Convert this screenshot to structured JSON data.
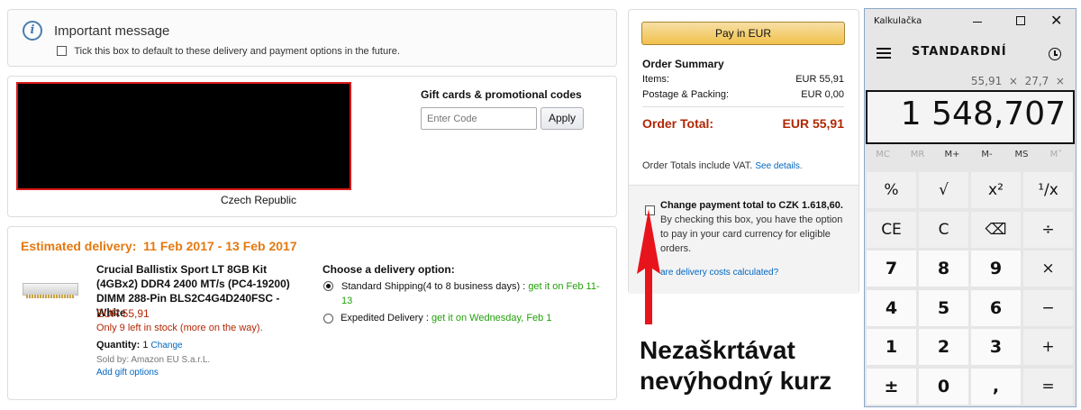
{
  "important": {
    "title": "Important message",
    "checkbox_label": "Tick this box to default to these delivery and payment options in the future."
  },
  "address": {
    "country": "Czech Republic"
  },
  "gift": {
    "title": "Gift cards & promotional codes",
    "placeholder": "Enter Code",
    "apply": "Apply"
  },
  "delivery": {
    "estimated_label": "Estimated delivery:",
    "estimated_dates": "11 Feb 2017 - 13 Feb 2017",
    "product_name": "Crucial Ballistix Sport LT 8GB Kit (4GBx2) DDR4 2400 MT/s (PC4-19200) DIMM 288-Pin BLS2C4G4D240FSC - White",
    "price": "EUR 55,91",
    "stock": "Only 9 left in stock (more on the way).",
    "quantity_label": "Quantity:",
    "quantity_value": "1",
    "change": "Change",
    "sold_by": "Sold by: Amazon EU S.a.r.L.",
    "gift_options": "Add gift options",
    "choose_label": "Choose a delivery option:",
    "option1_label": "Standard Shipping(4 to 8 business days) :",
    "option1_date": "get it on Feb 11-13",
    "option2_label": "Expedited Delivery :",
    "option2_date": "get it on Wednesday, Feb 1"
  },
  "summary": {
    "pay_button": "Pay in EUR",
    "title": "Order Summary",
    "items_label": "Items:",
    "items_value": "EUR 55,91",
    "postage_label": "Postage & Packing:",
    "postage_value": "EUR 0,00",
    "total_label": "Order Total:",
    "total_value": "EUR 55,91",
    "vat_note": "Order Totals include VAT.",
    "see_details": "See details.",
    "change_bold": "Change payment total to CZK 1.618,60.",
    "change_rest": " By checking this box, you have the option to pay in your card currency for eligible orders.",
    "delivery_costs": "are delivery costs calculated?"
  },
  "annotation": {
    "line1": "Nezaškrtávat",
    "line2": "nevýhodný kurz",
    "arrow_color": "#e8141c"
  },
  "calculator": {
    "window_title": "Kalkulačka",
    "mode": "STANDARDNÍ",
    "expression": "55,91  ×  27,7  ×",
    "display": "1 548,707",
    "memory": [
      "MC",
      "MR",
      "M+",
      "M-",
      "MS",
      "M˅"
    ],
    "keys": [
      [
        "%",
        "√",
        "x²",
        "¹/x"
      ],
      [
        "CE",
        "C",
        "⌫",
        "÷"
      ],
      [
        "7",
        "8",
        "9",
        "×"
      ],
      [
        "4",
        "5",
        "6",
        "−"
      ],
      [
        "1",
        "2",
        "3",
        "+"
      ],
      [
        "±",
        "0",
        ",",
        "="
      ]
    ]
  }
}
